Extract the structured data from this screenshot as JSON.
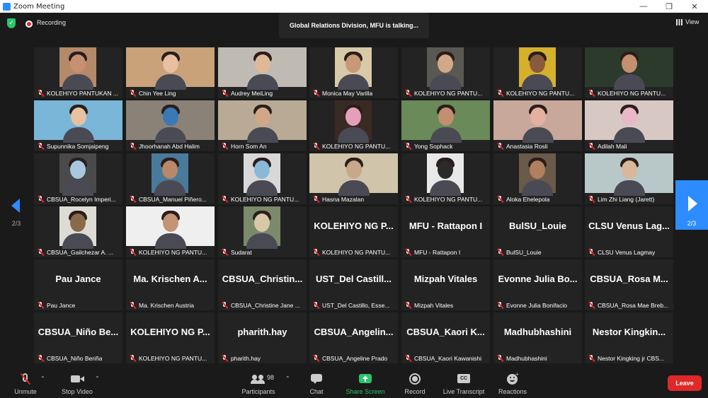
{
  "window": {
    "title": "Zoom Meeting",
    "controls": [
      "—",
      "❐",
      "✕"
    ]
  },
  "meeting": {
    "recording_label": "Recording",
    "talking_banner": "Global Relations Division, MFU is talking...",
    "view_label": "View",
    "page_indicator": "2/3"
  },
  "tiles": [
    {
      "name": "KOLEHIYO PANTUKAN ...",
      "video": true,
      "bg": "#b48a6a",
      "skin": "#c89070",
      "vx": 36,
      "vw": 52
    },
    {
      "name": "Chin Yee Ling",
      "video": true,
      "bg": "#c9a27a",
      "skin": "#e6c0a0",
      "vx": 0,
      "vw": 125
    },
    {
      "name": "Audrey MeiLing",
      "video": true,
      "bg": "#bfbab2",
      "skin": "#e1b896",
      "vx": 0,
      "vw": 125
    },
    {
      "name": "Monica May Varilla",
      "video": true,
      "bg": "#d8c9a8",
      "skin": "#c99878",
      "vx": 36,
      "vw": 52
    },
    {
      "name": "KOLEHIYO NG PANTU...",
      "video": true,
      "bg": "#5a5852",
      "skin": "#d2a888",
      "vx": 36,
      "vw": 52
    },
    {
      "name": "KOLEHIYO NG PANTU...",
      "video": true,
      "bg": "#d4b02c",
      "skin": "#8a5a3c",
      "vx": 36,
      "vw": 52
    },
    {
      "name": "KOLEHIYO NG PANTU...",
      "video": true,
      "bg": "#2c3a2c",
      "skin": "#c49070",
      "vx": 0,
      "vw": 125
    },
    {
      "name": "Supunnika Somjaipeng",
      "video": true,
      "bg": "#7ab6d8",
      "skin": "#e6c2a2",
      "vx": 0,
      "vw": 125
    },
    {
      "name": "Jhoorhanah Abd Halim",
      "video": true,
      "bg": "#8a8276",
      "skin": "#3a78b8",
      "vx": 0,
      "vw": 125
    },
    {
      "name": "Horn Som An",
      "video": true,
      "bg": "#b8aa94",
      "skin": "#d0a888",
      "vx": 0,
      "vw": 125
    },
    {
      "name": "KOLEHIYO NG PANTU...",
      "video": true,
      "bg": "#3a2a24",
      "skin": "#e4a0b8",
      "vx": 36,
      "vw": 52
    },
    {
      "name": "Yong Sophack",
      "video": true,
      "bg": "#6a8a5a",
      "skin": "#c09070",
      "vx": 0,
      "vw": 125
    },
    {
      "name": "Anastasia Rosli",
      "video": true,
      "bg": "#c8a89a",
      "skin": "#e4b0a0",
      "vx": 0,
      "vw": 125
    },
    {
      "name": "Adilah Mali",
      "video": true,
      "bg": "#d8c8c4",
      "skin": "#e8b8c8",
      "vx": 0,
      "vw": 125
    },
    {
      "name": "CBSUA_Rocelyn Imperi...",
      "video": true,
      "bg": "#4a4a4a",
      "skin": "#a8c8e0",
      "vx": 36,
      "vw": 52
    },
    {
      "name": "CBSUA_Manuel Piñero...",
      "video": true,
      "bg": "#4a7a9a",
      "skin": "#b88868",
      "vx": 36,
      "vw": 52
    },
    {
      "name": "KOLEHIYO NG PANTU...",
      "video": true,
      "bg": "#d8d8d8",
      "skin": "#8ab8d8",
      "vx": 36,
      "vw": 52
    },
    {
      "name": "Hasna Mazalan",
      "video": true,
      "bg": "#d0c4aa",
      "skin": "#c8a888",
      "vx": 0,
      "vw": 125
    },
    {
      "name": "KOLEHIYO NG PANTU...",
      "video": true,
      "bg": "#e8e8e8",
      "skin": "#2a2a2a",
      "vx": 36,
      "vw": 52
    },
    {
      "name": "Aloka Ehelepola",
      "video": true,
      "bg": "#6a5a4a",
      "skin": "#b08060",
      "vx": 36,
      "vw": 52
    },
    {
      "name": "Lim Zhi Liang (Jarett)",
      "video": true,
      "bg": "#b8c8c8",
      "skin": "#d8b898",
      "vx": 0,
      "vw": 125
    },
    {
      "name": "CBSUA_Gailchezar A. ...",
      "video": true,
      "bg": "#dcdcd4",
      "skin": "#8a6a4a",
      "vx": 36,
      "vw": 52
    },
    {
      "name": "KOLEHIYO NG PANTU...",
      "video": true,
      "bg": "#efefef",
      "skin": "#c49474",
      "vx": 0,
      "vw": 125
    },
    {
      "name": "Sudarat",
      "video": true,
      "bg": "#7a8a6a",
      "skin": "#d8c8a8",
      "vx": 36,
      "vw": 52
    },
    {
      "name": "KOLEHIYO NG PANTU...",
      "big": "KOLEHIYO NG P..."
    },
    {
      "name": "MFU - Rattapon I",
      "big": "MFU - Rattapon I"
    },
    {
      "name": "BulSU_Louie",
      "big": "BulSU_Louie"
    },
    {
      "name": "CLSU Venus Lagmay",
      "big": "CLSU Venus Lag..."
    },
    {
      "name": "Pau Jance",
      "big": "Pau Jance"
    },
    {
      "name": "Ma. Krischen Austria",
      "big": "Ma. Krischen A..."
    },
    {
      "name": "CBSUA_Christine Jane ...",
      "big": "CBSUA_Christin..."
    },
    {
      "name": "UST_Del Castillo, Esse...",
      "big": "UST_Del Castill..."
    },
    {
      "name": "Mizpah Vitales",
      "big": "Mizpah Vitales"
    },
    {
      "name": "Evonne Julia Bonifacio",
      "big": "Evonne Julia Bo..."
    },
    {
      "name": "CBSUA_Rosa Mae Breb...",
      "big": "CBSUA_Rosa M..."
    },
    {
      "name": "CBSUA_Niño Beriña",
      "big": "CBSUA_Niño Be..."
    },
    {
      "name": "KOLEHIYO NG PANTU...",
      "big": "KOLEHIYO NG P..."
    },
    {
      "name": "pharith.hay",
      "big": "pharith.hay"
    },
    {
      "name": "CBSUA_Angeline Prado",
      "big": "CBSUA_Angelin..."
    },
    {
      "name": "CBSUA_Kaori Kawanishi",
      "big": "CBSUA_Kaori K..."
    },
    {
      "name": "Madhubhashini",
      "big": "Madhubhashini"
    },
    {
      "name": "Nestor Kingking jr CBS...",
      "big": "Nestor Kingkin..."
    }
  ],
  "toolbar": {
    "unmute": "Unmute",
    "stop_video": "Stop Video",
    "participants": "Participants",
    "participant_count": "98",
    "chat": "Chat",
    "share_screen": "Share Screen",
    "record": "Record",
    "live_transcript": "Live Transcript",
    "reactions": "Reactions",
    "leave": "Leave",
    "cc_badge": "CC"
  },
  "colors": {
    "accent": "#2d8cff",
    "share_green": "#29c46b",
    "leave_red": "#e02828",
    "background": "#1a1a1a",
    "tile_bg": "#232323"
  }
}
